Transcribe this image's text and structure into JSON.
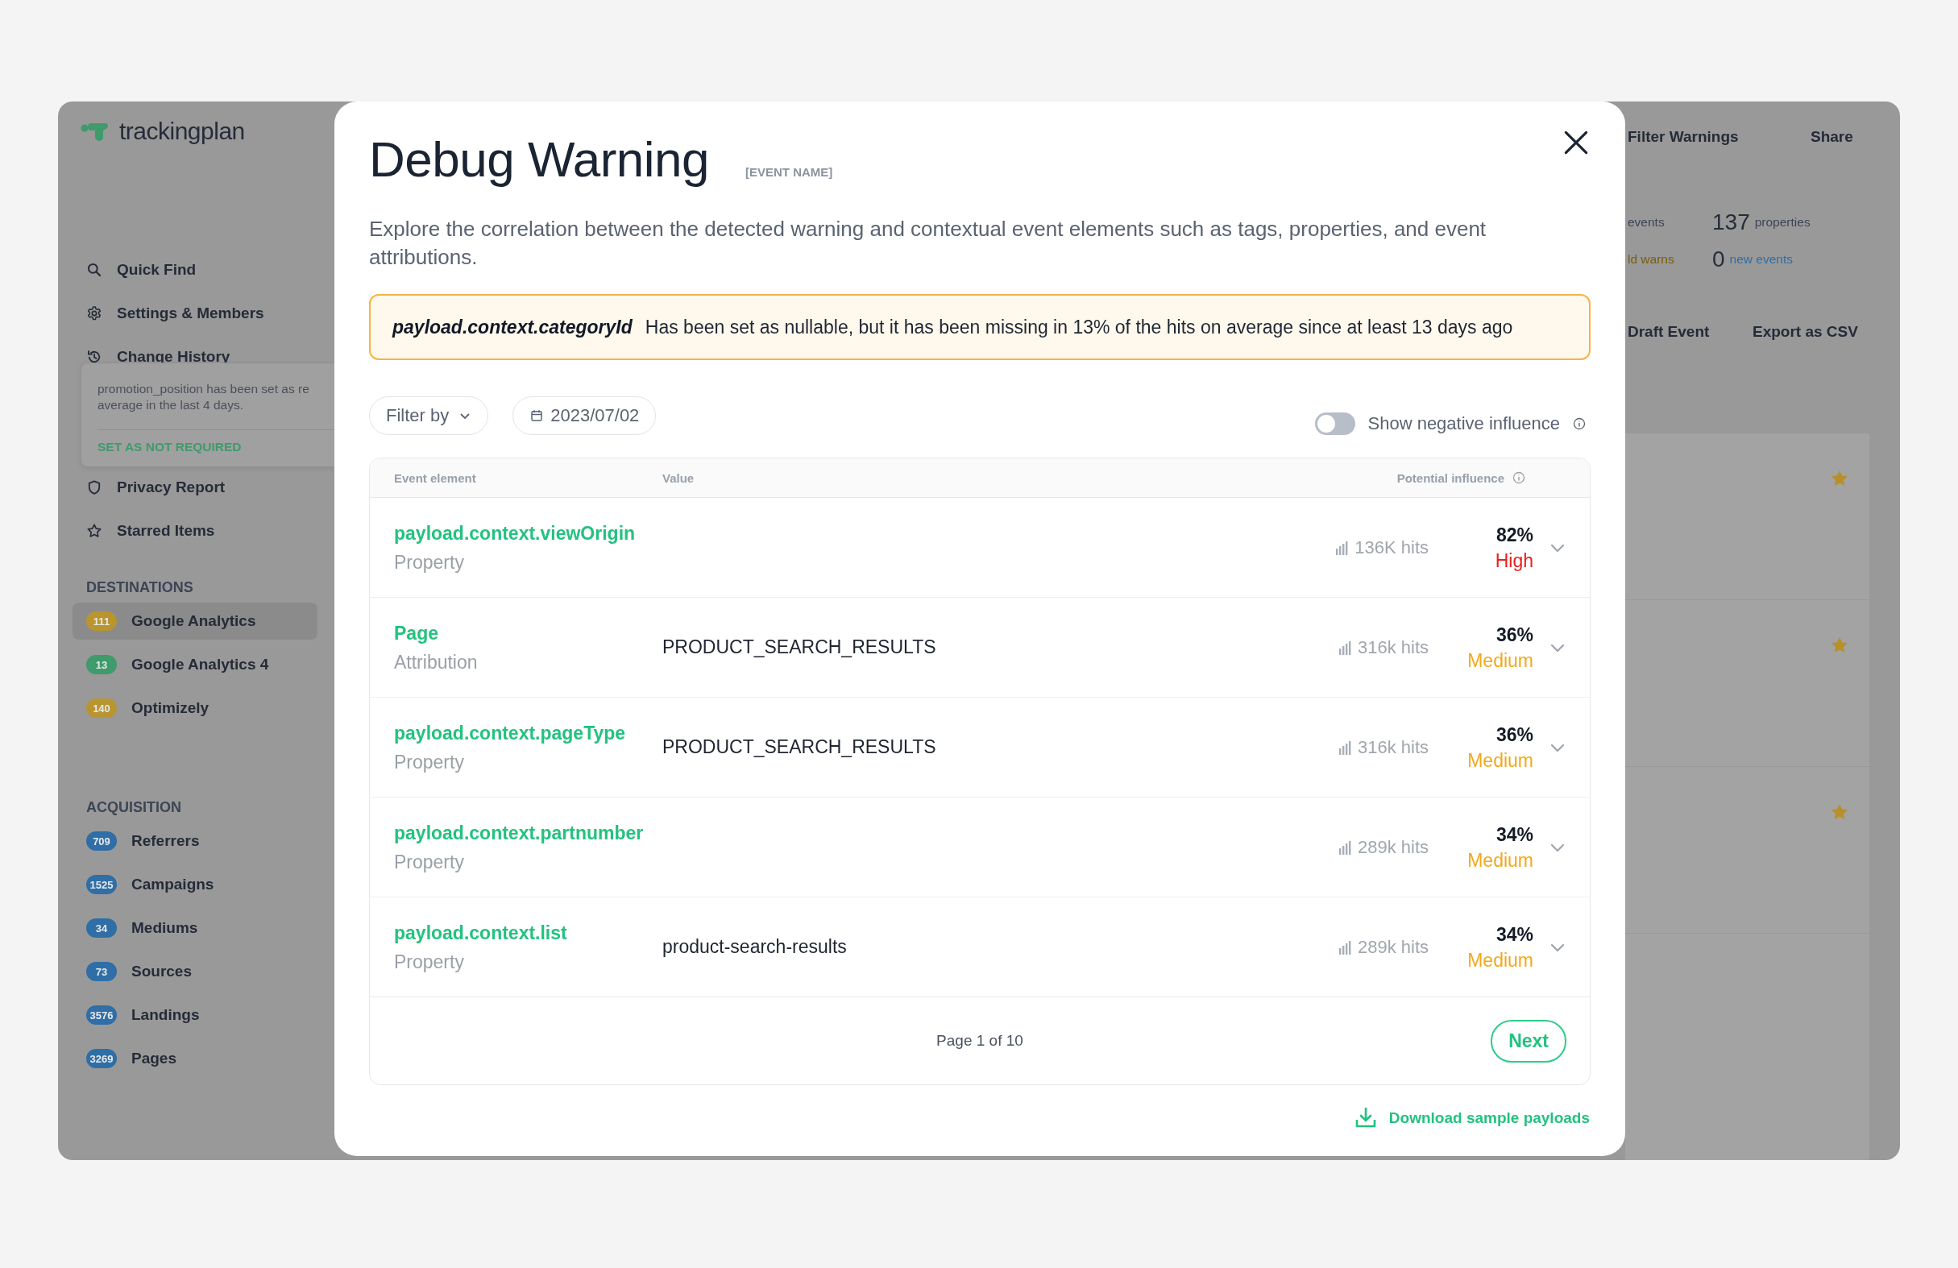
{
  "app": {
    "logo": "trackingplan",
    "nav": [
      {
        "label": "Quick Find",
        "kind": "search"
      },
      {
        "label": "Settings & Members",
        "kind": "gear"
      },
      {
        "label": "Change History",
        "kind": "history"
      }
    ],
    "tooltip": {
      "lines": [
        "promotion_position has been set as re",
        "average in the last 4 days."
      ],
      "action": "SET AS NOT REQUIRED"
    },
    "nav_lower": [
      {
        "label": "Privacy Report",
        "kind": "shield"
      },
      {
        "label": "Starred Items",
        "kind": "star"
      }
    ],
    "destinations": {
      "title": "DESTINATIONS",
      "items": [
        {
          "count": "111",
          "label": "Google Analytics",
          "color": "#b8952f",
          "selected": true
        },
        {
          "count": "13",
          "label": "Google Analytics 4",
          "color": "#3f9a6c",
          "selected": false
        },
        {
          "count": "140",
          "label": "Optimizely",
          "color": "#b8952f",
          "selected": false
        }
      ]
    },
    "acquisition": {
      "title": "ACQUISITION",
      "items": [
        {
          "count": "709",
          "label": "Referrers",
          "color": "#2f6ea6",
          "selected": false
        },
        {
          "count": "1525",
          "label": "Campaigns",
          "color": "#2f6ea6",
          "selected": false
        },
        {
          "count": "34",
          "label": "Mediums",
          "color": "#2f6ea6",
          "selected": false
        },
        {
          "count": "73",
          "label": "Sources",
          "color": "#2f6ea6",
          "selected": false
        },
        {
          "count": "3576",
          "label": "Landings",
          "color": "#2f6ea6",
          "selected": false
        },
        {
          "count": "3269",
          "label": "Pages",
          "color": "#2f6ea6",
          "selected": false
        }
      ]
    },
    "toolbar": [
      "Filter Warnings",
      "Share"
    ],
    "stats": {
      "events_label": "events",
      "properties_value": "137",
      "properties_label": "properties",
      "warns_label": "ld warns",
      "new_value": "0",
      "new_label": "new events"
    },
    "actions": [
      "Draft Event",
      "Export as CSV"
    ],
    "starred_rows": [
      {
        "starred": true
      },
      {
        "starred": true
      },
      {
        "starred": true
      }
    ]
  },
  "modal": {
    "title": "Debug Warning",
    "tag": "[EVENT NAME]",
    "description": "Explore the correlation between the detected warning and contextual event elements such as tags, properties, and event attributions.",
    "warning": {
      "field": "payload.context.categoryId",
      "message": "Has been set as nullable, but it has been missing in 13% of the hits on average since at least 13 days ago"
    },
    "filter": "Filter by",
    "date": "2023/07/02",
    "toggle": {
      "label": "Show negative influence",
      "on": false
    },
    "columns": [
      "Event element",
      "Value",
      "Potential influence"
    ],
    "rows": [
      {
        "element": "payload.context.viewOrigin",
        "type": "Property",
        "hits": "136K hits",
        "percent": "82%",
        "level_label": "High",
        "kind": "high",
        "expanded": false
      },
      {
        "element": "Page",
        "type": "Attribution",
        "value": "PRODUCT_SEARCH_RESULTS",
        "hits": "316k hits",
        "percent": "36%",
        "level_label": "Medium",
        "kind": "medium",
        "expanded": false
      },
      {
        "element": "payload.context.pageType",
        "type": "Property",
        "value": "PRODUCT_SEARCH_RESULTS",
        "hits": "316k hits",
        "percent": "36%",
        "level_label": "Medium",
        "kind": "medium",
        "expanded": false
      },
      {
        "element": "payload.context.partnumber",
        "type": "Property",
        "hits": "289k hits",
        "percent": "34%",
        "level_label": "Medium",
        "kind": "medium",
        "expanded": false
      },
      {
        "element": "payload.context.list",
        "type": "Property",
        "value": "product-search-results",
        "hits": "289k hits",
        "percent": "34%",
        "level_label": "Medium",
        "kind": "medium",
        "expanded": false
      }
    ],
    "page": "Page 1 of 10",
    "next": "Next",
    "download": "Download sample payloads"
  }
}
